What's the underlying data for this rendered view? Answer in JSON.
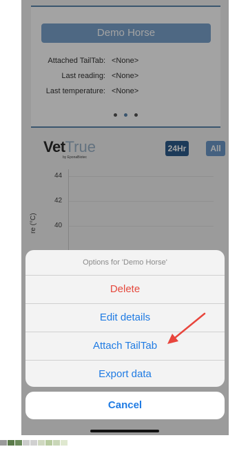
{
  "horse": {
    "name": "Demo Horse",
    "attached_label": "Attached TailTab:",
    "attached_value": "<None>",
    "reading_label": "Last reading:",
    "reading_value": "<None>",
    "temperature_label": "Last temperature:",
    "temperature_value": "<None>"
  },
  "chart": {
    "logo_vet": "Vet",
    "logo_true": "True",
    "logo_by": "by EponaBiotec",
    "range_24hr": "24Hr",
    "range_all": "All",
    "ylabel": "re (°C)",
    "ticks": [
      "44",
      "42",
      "40"
    ]
  },
  "chart_data": {
    "type": "line",
    "ylabel": "re (°C)",
    "ylim": [
      38,
      45
    ],
    "yticks": [
      40,
      42,
      44
    ],
    "series": []
  },
  "sheet": {
    "title": "Options for 'Demo Horse'",
    "actions": [
      "Delete",
      "Edit details",
      "Attach TailTab",
      "Export data"
    ],
    "cancel": "Cancel"
  },
  "colors": {
    "accent": "#1f7be3",
    "destructive": "#e5493d",
    "annotation_arrow": "#e8453c"
  },
  "icons": {
    "annotation": "red-arrow-icon"
  }
}
